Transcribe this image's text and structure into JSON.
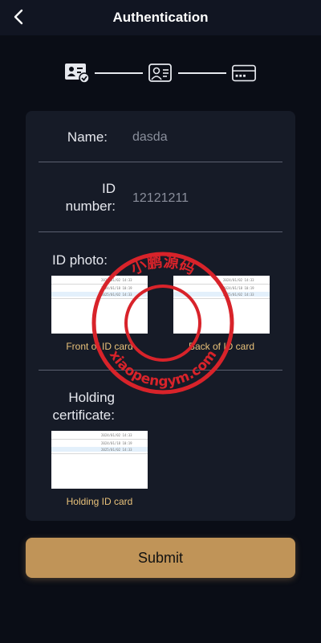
{
  "header": {
    "title": "Authentication",
    "back_icon": "chevron-left-icon"
  },
  "steps": {
    "icons": [
      "id-card-check-icon",
      "id-card-person-icon",
      "credit-card-icon"
    ]
  },
  "form": {
    "name_label": "Name:",
    "name_value": "dasda",
    "id_label_line1": "ID",
    "id_label_line2": "number:",
    "id_value": "12121211",
    "id_photo_label": "ID photo:",
    "front_caption": "Front of ID card",
    "back_caption": "Back of ID card",
    "holding_label_line1": "Holding",
    "holding_label_line2": "certificate:",
    "holding_caption": "Holding ID card"
  },
  "thumb_text": {
    "row1": "2024/01/02 14:33",
    "row2": "2024/01/18 10:19",
    "row3": "2025/01/02 14:33"
  },
  "submit_label": "Submit",
  "watermark": {
    "top_text": "小鹏源码",
    "bottom_text": "xiaopengym.com",
    "color": "#d8232a"
  },
  "colors": {
    "accent": "#c09458",
    "caption": "#e9c27a",
    "card_bg": "#161b27",
    "page_bg": "#0a0d16"
  }
}
